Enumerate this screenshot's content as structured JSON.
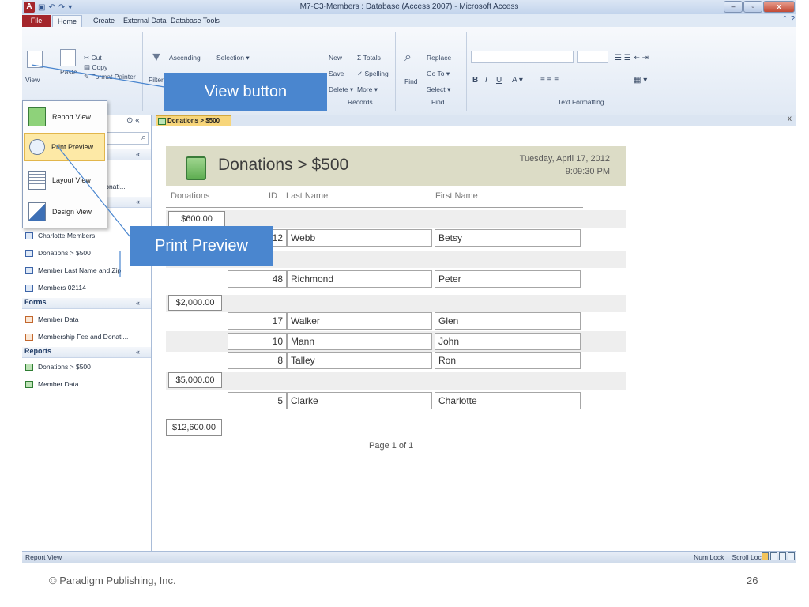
{
  "window": {
    "title": "M7-C3-Members : Database (Access 2007) - Microsoft Access",
    "controls": [
      "–",
      "▫",
      "x"
    ]
  },
  "ribbon": {
    "tabs": [
      "File",
      "Home",
      "Create",
      "External Data",
      "Database Tools"
    ],
    "views_group": {
      "view_label": "View"
    },
    "clipboard_group": {
      "paste_label": "Paste",
      "cut_label": "Cut",
      "copy_label": "Copy",
      "format_painter_label": "Format Painter"
    },
    "sort_filter_group": {
      "filter_label": "Filter",
      "ascending_label": "Ascending",
      "selection_label": "Selection ▾"
    },
    "records_group": {
      "new_label": "New",
      "save_label": "Save",
      "delete_label": "Delete ▾",
      "totals_label": "Totals",
      "spelling_label": "Spelling",
      "more_label": "More ▾",
      "group_label": "Records"
    },
    "find_group": {
      "find_label": "Find",
      "replace_label": "Replace",
      "goto_label": "Go To ▾",
      "select_label": "Select ▾",
      "group_label": "Find"
    },
    "text_formatting_group": {
      "group_label": "Text Formatting"
    }
  },
  "view_menu": {
    "items": [
      {
        "label": "Report View"
      },
      {
        "label": "Print Preview"
      },
      {
        "label": "Layout View"
      },
      {
        "label": "Design View"
      }
    ]
  },
  "navigation_pane": {
    "search_partial": "d Donati...",
    "queries": [
      "Charlotte Members",
      "Donations > $500",
      "Member Last Name and Zip",
      "Members 02114"
    ],
    "forms_header": "Forms",
    "forms": [
      "Member Data",
      "Membership Fee and Donati..."
    ],
    "reports_header": "Reports",
    "reports": [
      "Donations > $500",
      "Member Data"
    ]
  },
  "document_tab": {
    "label": "Donations > $500"
  },
  "report": {
    "title": "Donations > $500",
    "date": "Tuesday, April 17, 2012",
    "time": "9:09:30 PM",
    "columns": {
      "donations": "Donations",
      "id": "ID",
      "last_name": "Last Name",
      "first_name": "First Name"
    },
    "groups": [
      {
        "amount": "$600.00",
        "rows": [
          {
            "id": "12",
            "last": "Webb",
            "first": "Betsy"
          }
        ]
      },
      {
        "amount": "",
        "rows": [
          {
            "id": "48",
            "last": "Richmond",
            "first": "Peter"
          }
        ]
      },
      {
        "amount": "$2,000.00",
        "rows": [
          {
            "id": "17",
            "last": "Walker",
            "first": "Glen"
          },
          {
            "id": "10",
            "last": "Mann",
            "first": "John"
          },
          {
            "id": "8",
            "last": "Talley",
            "first": "Ron"
          }
        ]
      },
      {
        "amount": "$5,000.00",
        "rows": [
          {
            "id": "5",
            "last": "Clarke",
            "first": "Charlotte"
          }
        ]
      }
    ],
    "total": "$12,600.00",
    "page": "Page 1 of 1"
  },
  "status_bar": {
    "left": "Report View",
    "num_lock": "Num Lock",
    "scroll_lock": "Scroll Lock"
  },
  "callouts": {
    "view_button": "View button",
    "print_preview": "Print Preview"
  },
  "slide": {
    "copyright": "© Paradigm Publishing, Inc.",
    "number": "26"
  },
  "colors": {
    "callout": "#4a86cf",
    "file_tab": "#a4262c",
    "report_header": "#dcdcc6"
  }
}
